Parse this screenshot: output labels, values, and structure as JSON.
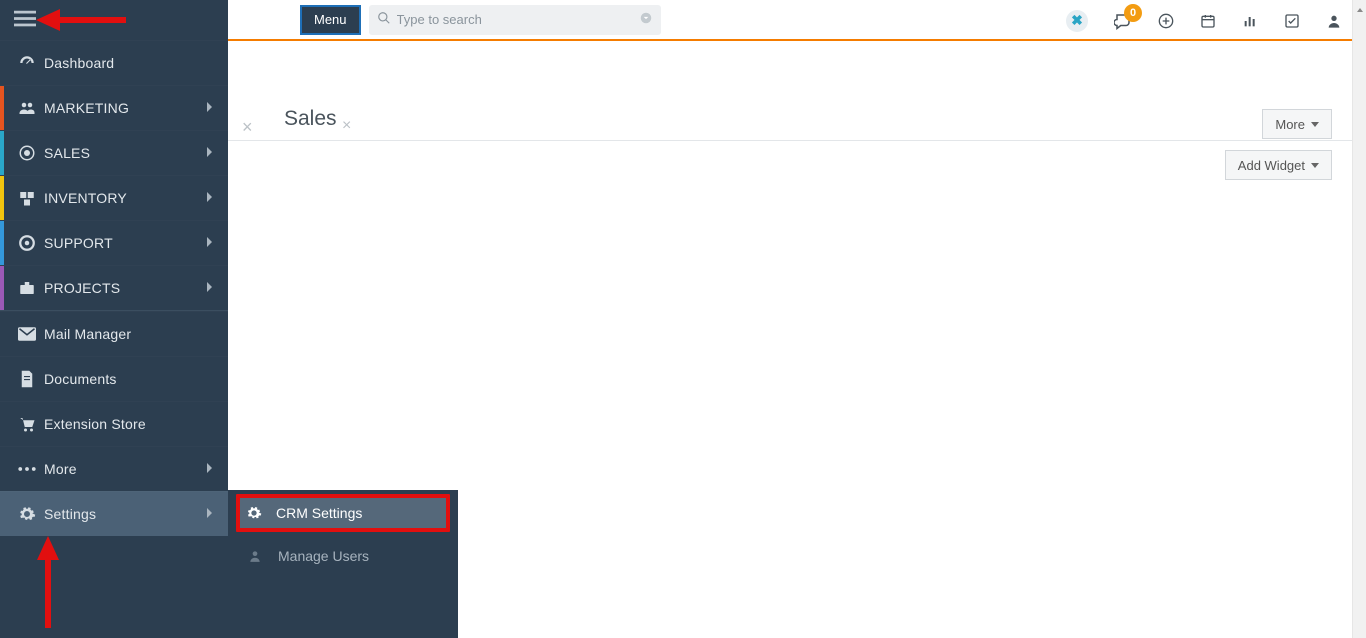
{
  "header": {
    "menu_button": "Menu",
    "search_placeholder": "Type to search",
    "notification_count": "0"
  },
  "sidebar": {
    "dashboard": "Dashboard",
    "marketing": "MARKETING",
    "sales": "SALES",
    "inventory": "INVENTORY",
    "support": "SUPPORT",
    "projects": "PROJECTS",
    "mail_manager": "Mail Manager",
    "documents": "Documents",
    "extension_store": "Extension Store",
    "more": "More",
    "settings": "Settings"
  },
  "submenu": {
    "crm_settings": "CRM Settings",
    "manage_users": "Manage Users"
  },
  "tabs": {
    "title": "Sales"
  },
  "buttons": {
    "more": "More",
    "add_widget": "Add Widget"
  },
  "colors": {
    "stripe_marketing": "#e55420",
    "stripe_sales": "#2aa7c9",
    "stripe_inventory": "#f1c40f",
    "stripe_support": "#3498db",
    "stripe_projects": "#9b59b6"
  }
}
